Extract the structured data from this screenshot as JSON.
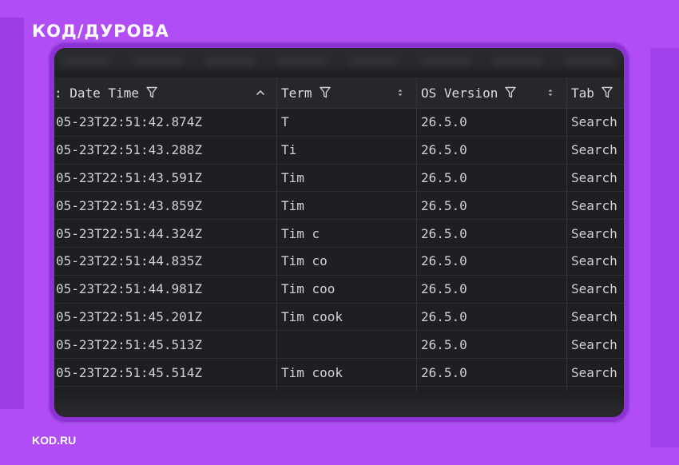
{
  "brand": {
    "logo_text": "КОД/ДУРОВА"
  },
  "footer": {
    "site": "KOD.RU"
  },
  "table": {
    "columns": [
      {
        "label": ": Date Time",
        "sort": "asc"
      },
      {
        "label": "Term",
        "sort": "none"
      },
      {
        "label": "OS Version",
        "sort": "none"
      },
      {
        "label": "Tab",
        "sort": "none"
      }
    ],
    "rows": [
      {
        "datetime": "05-23T22:51:42.874Z",
        "term": "T",
        "os": "26.5.0",
        "tab": "Search"
      },
      {
        "datetime": "05-23T22:51:43.288Z",
        "term": "Ti",
        "os": "26.5.0",
        "tab": "Search"
      },
      {
        "datetime": "05-23T22:51:43.591Z",
        "term": "Tim",
        "os": "26.5.0",
        "tab": "Search"
      },
      {
        "datetime": "05-23T22:51:43.859Z",
        "term": "Tim",
        "os": "26.5.0",
        "tab": "Search"
      },
      {
        "datetime": "05-23T22:51:44.324Z",
        "term": "Tim c",
        "os": "26.5.0",
        "tab": "Search"
      },
      {
        "datetime": "05-23T22:51:44.835Z",
        "term": "Tim co",
        "os": "26.5.0",
        "tab": "Search"
      },
      {
        "datetime": "05-23T22:51:44.981Z",
        "term": "Tim coo",
        "os": "26.5.0",
        "tab": "Search"
      },
      {
        "datetime": "05-23T22:51:45.201Z",
        "term": "Tim cook",
        "os": "26.5.0",
        "tab": "Search"
      },
      {
        "datetime": "05-23T22:51:45.513Z",
        "term": "",
        "os": "26.5.0",
        "tab": "Search"
      },
      {
        "datetime": "05-23T22:51:45.514Z",
        "term": "Tim cook",
        "os": "26.5.0",
        "tab": "Search"
      }
    ]
  },
  "colors": {
    "background": "#b04df5",
    "table_bg": "#1e1f22",
    "header_bg": "#26272b",
    "text": "#d2d2d6"
  },
  "icons": {
    "filter": "filter-funnel-icon",
    "sort_asc": "chevron-up-icon",
    "sort_both": "sort-updown-icon"
  }
}
